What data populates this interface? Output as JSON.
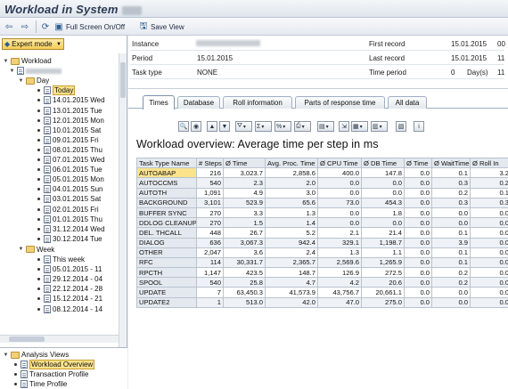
{
  "window": {
    "title": "Workload in System"
  },
  "toolbar": {
    "back_icon": "arrow-left-icon",
    "forward_icon": "arrow-right-icon",
    "full_screen_label": "Full Screen On/Off",
    "save_view_label": "Save View"
  },
  "left": {
    "mode_label": "Expert mode",
    "tree": {
      "root": "Workload",
      "day_folder": "Day",
      "days": [
        "Today",
        "14.01.2015 Wed",
        "13.01.2015 Tue",
        "12.01.2015 Mon",
        "10.01.2015 Sat",
        "09.01.2015 Fri",
        "08.01.2015 Thu",
        "07.01.2015 Wed",
        "06.01.2015 Tue",
        "05.01.2015 Mon",
        "04.01.2015 Sun",
        "03.01.2015 Sat",
        "02.01.2015 Fri",
        "01.01.2015 Thu",
        "31.12.2014 Wed",
        "30.12.2014 Tue"
      ],
      "week_folder": "Week",
      "weeks": [
        "This week",
        "05.01.2015 - 11",
        "29.12.2014 - 04",
        "22.12.2014 - 28",
        "15.12.2014 - 21",
        "08.12.2014 - 14"
      ]
    },
    "analysis": {
      "header": "Analysis Views",
      "items": [
        "Workload Overview",
        "Transaction Profile",
        "Time Profile"
      ]
    }
  },
  "header": {
    "instance_label": "Instance",
    "period_label": "Period",
    "period_value": "15.01.2015",
    "task_type_label": "Task type",
    "task_type_value": "NONE",
    "first_record_label": "First record",
    "first_record_value": "15.01.2015",
    "first_record_time": "00",
    "last_record_label": "Last record",
    "last_record_value": "15.01.2015",
    "last_record_time": "11",
    "time_period_label": "Time period",
    "time_period_value": "0",
    "time_period_unit": "Day(s)",
    "time_period_time": "11"
  },
  "tabs": [
    "Times",
    "Database",
    "Roll information",
    "Parts of response time",
    "All data"
  ],
  "grid": {
    "title": "Workload overview: Average time per step in ms",
    "columns": [
      "Task Type Name",
      "# Steps",
      "Ø Time",
      "Avg. Proc. Time",
      "Ø CPU Time",
      "Ø DB Time",
      "Ø Time",
      "Ø WaitTime",
      "Ø Roll In"
    ],
    "rows": [
      [
        "AUTOABAP",
        "216",
        "3,023.7",
        "2,858.6",
        "400.0",
        "147.8",
        "0.0",
        "0.1",
        "3.2"
      ],
      [
        "AUTOCCMS",
        "540",
        "2.3",
        "2.0",
        "0.0",
        "0.0",
        "0.0",
        "0.3",
        "0.2"
      ],
      [
        "AUTOTH",
        "1,091",
        "4.9",
        "3.0",
        "0.0",
        "0.0",
        "0.0",
        "0.2",
        "0.1"
      ],
      [
        "BACKGROUND",
        "3,101",
        "523.9",
        "65.6",
        "73.0",
        "454.3",
        "0.0",
        "0.3",
        "0.3"
      ],
      [
        "BUFFER SYNC",
        "270",
        "3.3",
        "1.3",
        "0.0",
        "1.8",
        "0.0",
        "0.0",
        "0.0"
      ],
      [
        "DDLOG CLEANUP",
        "270",
        "1.5",
        "1.4",
        "0.0",
        "0.0",
        "0.0",
        "0.0",
        "0.0"
      ],
      [
        "DEL. THCALL",
        "448",
        "26.7",
        "5.2",
        "2.1",
        "21.4",
        "0.0",
        "0.1",
        "0.0"
      ],
      [
        "DIALOG",
        "636",
        "3,067.3",
        "942.4",
        "329.1",
        "1,198.7",
        "0.0",
        "3.9",
        "0.0"
      ],
      [
        "OTHER",
        "2,047",
        "3.6",
        "2.4",
        "1.3",
        "1.1",
        "0.0",
        "0.1",
        "0.0"
      ],
      [
        "RFC",
        "114",
        "30,331.7",
        "2,365.7",
        "2,569.6",
        "1,265.9",
        "0.0",
        "0.1",
        "0.0"
      ],
      [
        "RPCTH",
        "1,147",
        "423.5",
        "148.7",
        "126.9",
        "272.5",
        "0.0",
        "0.2",
        "0.0"
      ],
      [
        "SPOOL",
        "540",
        "25.8",
        "4.7",
        "4.2",
        "20.6",
        "0.0",
        "0.2",
        "0.0"
      ],
      [
        "UPDATE",
        "7",
        "63,450.3",
        "41,573.9",
        "43,756.7",
        "20,661.1",
        "0.0",
        "0.0",
        "0.0"
      ],
      [
        "UPDATE2",
        "1",
        "513.0",
        "42.0",
        "47.0",
        "275.0",
        "0.0",
        "0.0",
        "0.0"
      ]
    ]
  },
  "colors": {
    "selection": "#fbe38c",
    "header_bg": "#e4e9ef",
    "accent": "#2e5d94"
  }
}
